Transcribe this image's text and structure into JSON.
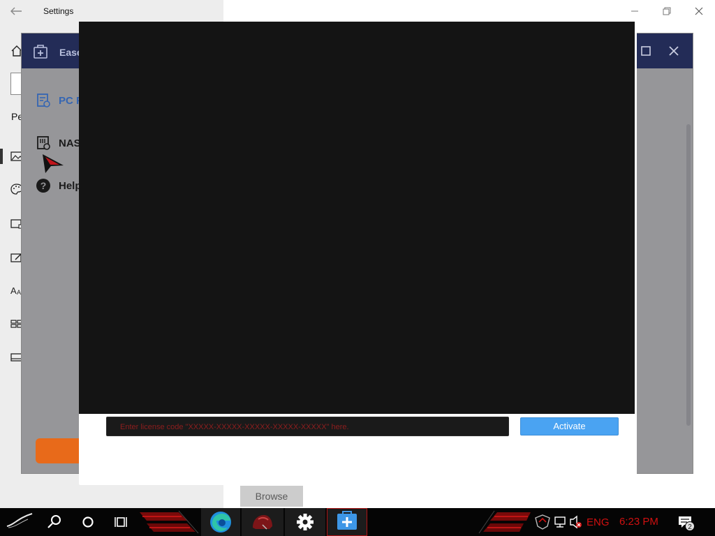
{
  "settings_window": {
    "title": "Settings",
    "section_label": "Pe"
  },
  "app_window": {
    "title": "Ease",
    "nav": [
      {
        "label": "PC F",
        "icon": "pc-backup-icon"
      },
      {
        "label": "NAS",
        "icon": "nas-icon"
      },
      {
        "label": "Help",
        "icon": "help-icon"
      }
    ]
  },
  "dialog": {
    "license_placeholder": "Enter license code \"XXXXX-XXXXX-XXXXX-XXXXX-XXXXX\" here.",
    "activate_label": "Activate"
  },
  "browse_button": {
    "label": "Browse"
  },
  "taskbar": {
    "pinned": [
      "start-icon",
      "search-icon",
      "cortana-icon",
      "task-view-icon",
      "edge-icon",
      "game-app-icon",
      "settings-gear-icon",
      "easeus-icon"
    ],
    "tray": {
      "language": "ENG",
      "clock": "6:23 PM",
      "notification_count": "2"
    }
  },
  "colors": {
    "app_header": "#232c57",
    "accent_blue": "#4aa3f2",
    "alert_red": "#d01010",
    "orange": "#e86a1a"
  }
}
